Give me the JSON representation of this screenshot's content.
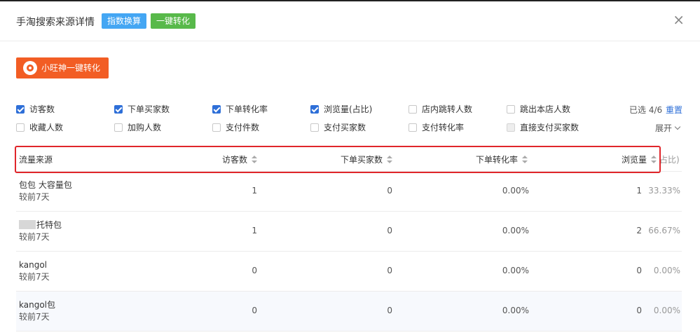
{
  "header": {
    "title": "手淘搜索来源详情",
    "tag_index": "指数换算",
    "tag_convert": "一键转化",
    "close": "×"
  },
  "wangwang_button": "小旺神一键转化",
  "filters": {
    "row1": [
      {
        "label": "访客数",
        "checked": true
      },
      {
        "label": "下单买家数",
        "checked": true
      },
      {
        "label": "下单转化率",
        "checked": true
      },
      {
        "label": "浏览量(占比)",
        "checked": true
      },
      {
        "label": "店内跳转人数",
        "checked": false
      },
      {
        "label": "跳出本店人数",
        "checked": false
      }
    ],
    "row2": [
      {
        "label": "收藏人数",
        "checked": false
      },
      {
        "label": "加购人数",
        "checked": false
      },
      {
        "label": "支付件数",
        "checked": false
      },
      {
        "label": "支付买家数",
        "checked": false
      },
      {
        "label": "支付转化率",
        "checked": false
      },
      {
        "label": "直接支付买家数",
        "checked": false,
        "disabled": true
      }
    ],
    "selected_text": "已选 4/6",
    "reset": "重置",
    "expand": "展开"
  },
  "table": {
    "columns": [
      "流量来源",
      "访客数",
      "下单买家数",
      "下单转化率",
      "浏览量",
      "占比)"
    ],
    "rows": [
      {
        "source": "包包 大容量包",
        "compare": "较前7天",
        "visitors": "1",
        "buyers": "0",
        "rate": "0.00%",
        "views": "1",
        "share": "33.33%"
      },
      {
        "source": "托特包",
        "compare": "较前7天",
        "visitors": "1",
        "buyers": "0",
        "rate": "0.00%",
        "views": "2",
        "share": "66.67%"
      },
      {
        "source": "kangol",
        "compare": "较前7天",
        "visitors": "0",
        "buyers": "0",
        "rate": "0.00%",
        "views": "0",
        "share": "0.00%"
      },
      {
        "source": "kangol包",
        "compare": "较前7天",
        "visitors": "0",
        "buyers": "0",
        "rate": "0.00%",
        "views": "0",
        "share": "0.00%"
      }
    ]
  },
  "colors": {
    "accent_blue": "#2e6fd8",
    "tag_blue": "#44a6f3",
    "tag_green": "#58b94a",
    "wangwang_orange": "#f25d24",
    "highlight_red": "#e0262b"
  }
}
